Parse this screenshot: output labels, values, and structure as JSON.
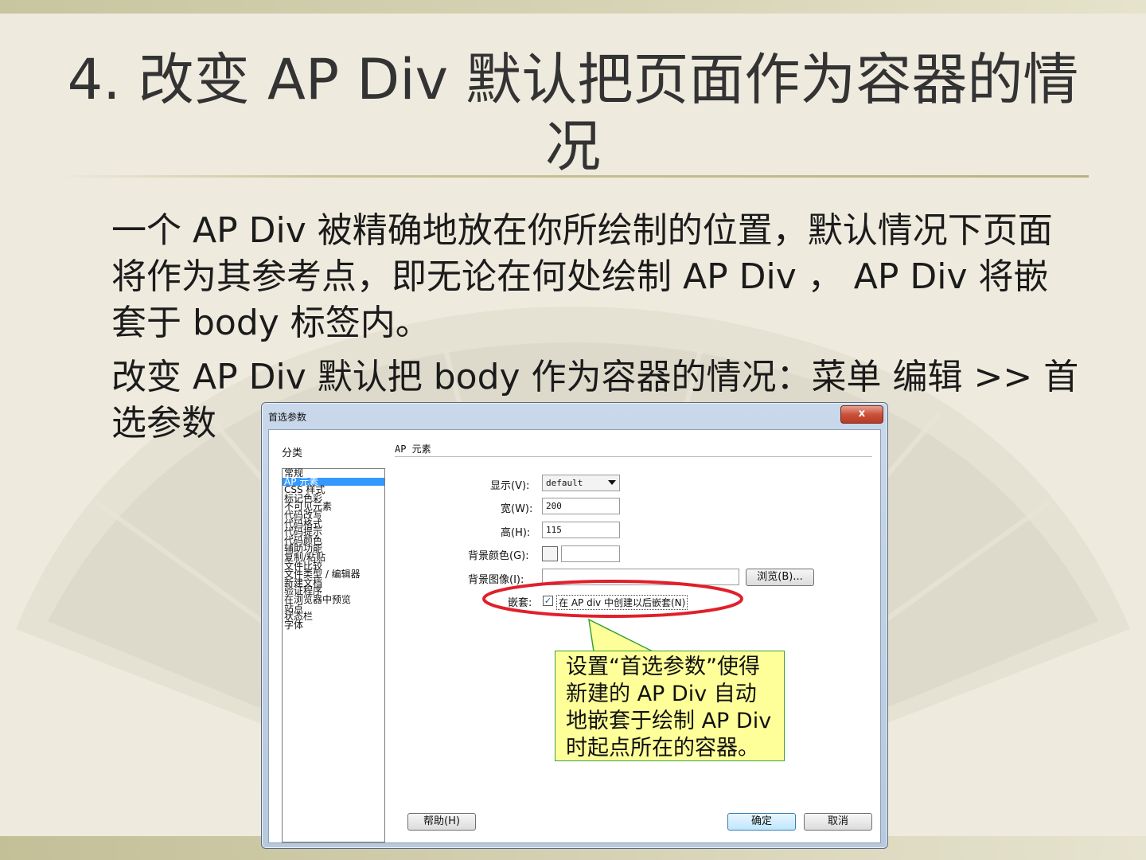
{
  "slide": {
    "title": "4. 改变 AP Div 默认把页面作为容器的情况",
    "bullets": [
      "一个 AP Div 被精确地放在你所绘制的位置，默认情况下页面将作为其参考点，即无论在何处绘制 AP Div ， AP Div 将嵌套于 body 标签内。",
      "改变 AP Div 默认把 body 作为容器的情况：菜单 编辑 >> 首选参数"
    ],
    "bullet_marker": "",
    "callout": "设置“首选参数”使得新建的 AP Div 自动地嵌套于绘制 AP Div 时起点所在的容器。"
  },
  "dialog": {
    "title": "首选参数",
    "close": "x",
    "category_header": "分类",
    "categories": [
      "常规",
      "AP 元素",
      "CSS 样式",
      "标记色彩",
      "不可见元素",
      "代码改写",
      "代码格式",
      "代码提示",
      "代码颜色",
      "辅助功能",
      "复制/粘贴",
      "文件比较",
      "文件类型 / 编辑器",
      "新建文档",
      "验证程序",
      "在浏览器中预览",
      "站点",
      "状态栏",
      "字体"
    ],
    "selected_category": 1,
    "panel_title": "AP 元素",
    "display_label": "显示(V):",
    "display_value": "default",
    "width_label": "宽(W):",
    "width_value": "200",
    "height_label": "高(H):",
    "height_value": "115",
    "bgcolor_label": "背景颜色(G):",
    "bgimage_label": "背景图像(I):",
    "browse_button": "浏览(B)...",
    "nesting_label": "嵌套:",
    "nesting_checkbox_label": "在 AP div 中创建以后嵌套(N)",
    "nesting_checked": true,
    "check_mark": "✓",
    "help_button": "帮助(H)",
    "ok_button": "确定",
    "cancel_button": "取消"
  }
}
